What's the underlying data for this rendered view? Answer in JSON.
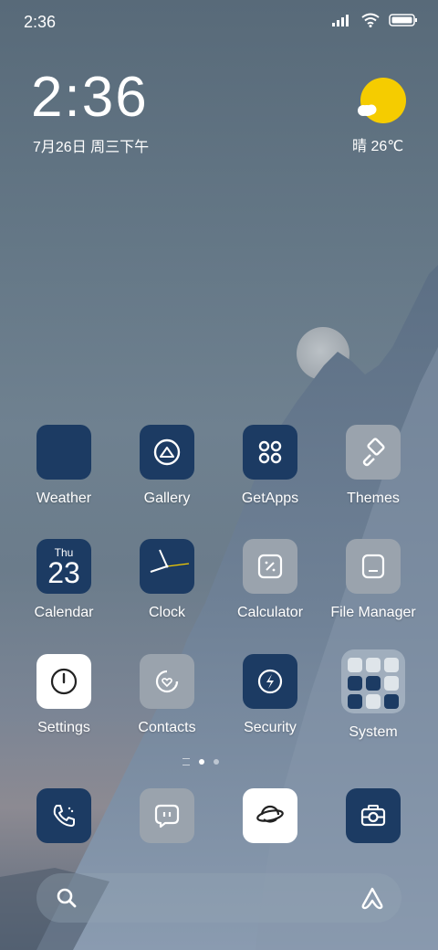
{
  "status_bar": {
    "time": "2:36"
  },
  "clock_widget": {
    "time": "2:36",
    "date": "7月26日 周三下午"
  },
  "weather_widget": {
    "text": "晴 26℃"
  },
  "apps": {
    "weather": "Weather",
    "gallery": "Gallery",
    "getapps": "GetApps",
    "themes": "Themes",
    "calendar": "Calendar",
    "clock": "Clock",
    "calculator": "Calculator",
    "file_manager": "File Manager",
    "settings": "Settings",
    "contacts": "Contacts",
    "security": "Security",
    "system": "System"
  },
  "calendar_icon": {
    "day": "Thu",
    "date": "23"
  },
  "page_indicator": {
    "current": 1,
    "total": 2
  },
  "colors": {
    "navy": "#1c3b63",
    "gray_icon": "#9aa3ad",
    "sun": "#f5cc00"
  }
}
